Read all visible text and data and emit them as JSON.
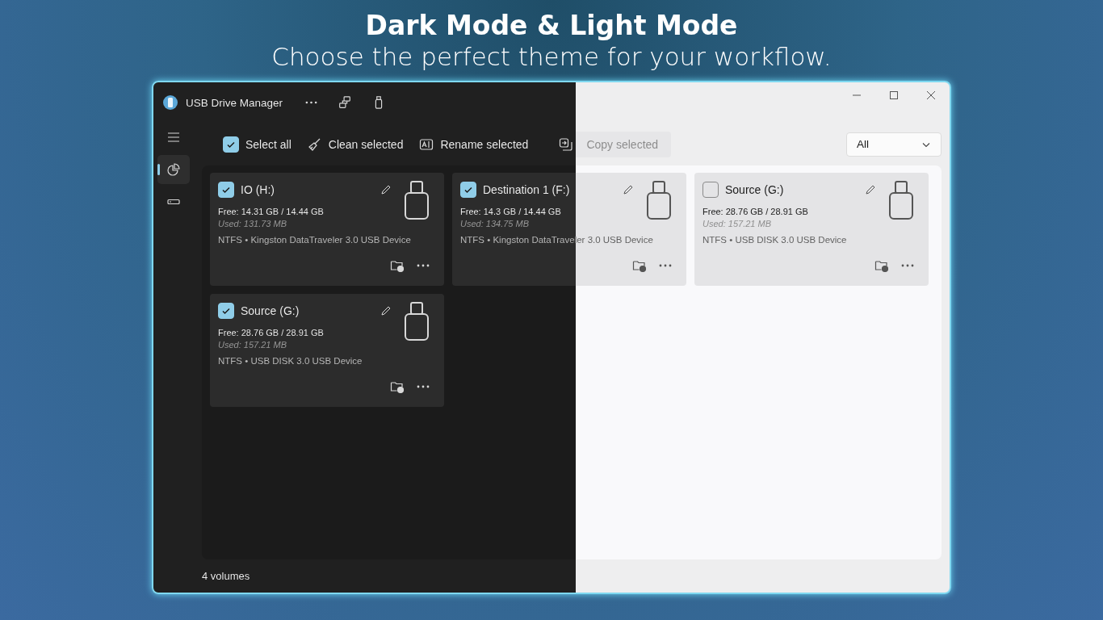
{
  "headline": {
    "title": "Dark Mode & Light Mode",
    "subtitle": "Choose the perfect theme for your workflow."
  },
  "window": {
    "title": "USB Drive Manager"
  },
  "nav": [
    {
      "kind": "chart",
      "selected": true
    },
    {
      "kind": "drive",
      "selected": false
    }
  ],
  "toolbar": {
    "select_all": {
      "label": "Select all",
      "checked": true
    },
    "actions": [
      {
        "kind": "clean",
        "label": "Clean selected",
        "disabled": false
      },
      {
        "kind": "rename",
        "label": "Rename selected",
        "disabled": false
      },
      {
        "kind": "copy",
        "label": "Copy selected",
        "disabled": true
      }
    ],
    "filter": {
      "value": "All"
    }
  },
  "drives": [
    {
      "name": "IO (H:)",
      "checked": true,
      "free": "Free: 14.31 GB / 14.44 GB",
      "used": "Used: 131.73 MB",
      "details": "NTFS • Kingston DataTraveler 3.0 USB Device"
    },
    {
      "name": "Destination 1 (F:)",
      "checked": true,
      "free": "Free: 14.3 GB / 14.44 GB",
      "used": "Used: 134.75 MB",
      "details": "NTFS • Kingston DataTraveler 3.0 USB Device"
    },
    {
      "name": "Source (G:)",
      "checked": false,
      "free": "Free: 28.76 GB / 28.91 GB",
      "used": "Used: 157.21 MB",
      "details": "NTFS • USB DISK 3.0 USB Device"
    },
    {
      "name": "Source (G:)",
      "checked": true,
      "free": "Free: 28.76 GB / 28.91 GB",
      "used": "Used: 157.21 MB",
      "details": "NTFS • USB DISK 3.0 USB Device"
    }
  ],
  "status_bar": "4 volumes"
}
